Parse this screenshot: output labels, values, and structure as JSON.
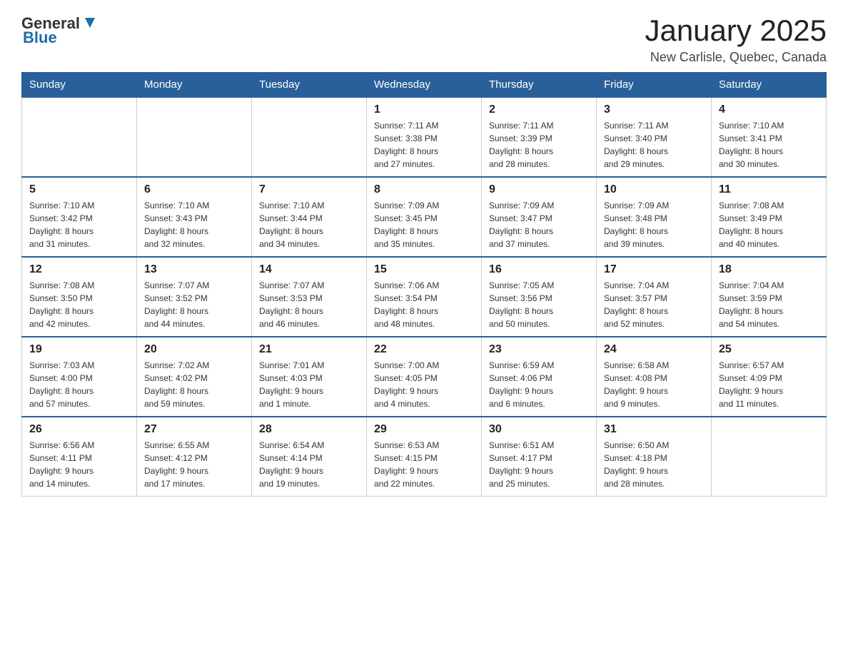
{
  "header": {
    "logo": {
      "text_general": "General",
      "text_blue": "Blue",
      "aria": "GeneralBlue Logo"
    },
    "title": "January 2025",
    "location": "New Carlisle, Quebec, Canada"
  },
  "calendar": {
    "days_of_week": [
      "Sunday",
      "Monday",
      "Tuesday",
      "Wednesday",
      "Thursday",
      "Friday",
      "Saturday"
    ],
    "weeks": [
      {
        "days": [
          {
            "num": "",
            "info": ""
          },
          {
            "num": "",
            "info": ""
          },
          {
            "num": "",
            "info": ""
          },
          {
            "num": "1",
            "info": "Sunrise: 7:11 AM\nSunset: 3:38 PM\nDaylight: 8 hours\nand 27 minutes."
          },
          {
            "num": "2",
            "info": "Sunrise: 7:11 AM\nSunset: 3:39 PM\nDaylight: 8 hours\nand 28 minutes."
          },
          {
            "num": "3",
            "info": "Sunrise: 7:11 AM\nSunset: 3:40 PM\nDaylight: 8 hours\nand 29 minutes."
          },
          {
            "num": "4",
            "info": "Sunrise: 7:10 AM\nSunset: 3:41 PM\nDaylight: 8 hours\nand 30 minutes."
          }
        ]
      },
      {
        "days": [
          {
            "num": "5",
            "info": "Sunrise: 7:10 AM\nSunset: 3:42 PM\nDaylight: 8 hours\nand 31 minutes."
          },
          {
            "num": "6",
            "info": "Sunrise: 7:10 AM\nSunset: 3:43 PM\nDaylight: 8 hours\nand 32 minutes."
          },
          {
            "num": "7",
            "info": "Sunrise: 7:10 AM\nSunset: 3:44 PM\nDaylight: 8 hours\nand 34 minutes."
          },
          {
            "num": "8",
            "info": "Sunrise: 7:09 AM\nSunset: 3:45 PM\nDaylight: 8 hours\nand 35 minutes."
          },
          {
            "num": "9",
            "info": "Sunrise: 7:09 AM\nSunset: 3:47 PM\nDaylight: 8 hours\nand 37 minutes."
          },
          {
            "num": "10",
            "info": "Sunrise: 7:09 AM\nSunset: 3:48 PM\nDaylight: 8 hours\nand 39 minutes."
          },
          {
            "num": "11",
            "info": "Sunrise: 7:08 AM\nSunset: 3:49 PM\nDaylight: 8 hours\nand 40 minutes."
          }
        ]
      },
      {
        "days": [
          {
            "num": "12",
            "info": "Sunrise: 7:08 AM\nSunset: 3:50 PM\nDaylight: 8 hours\nand 42 minutes."
          },
          {
            "num": "13",
            "info": "Sunrise: 7:07 AM\nSunset: 3:52 PM\nDaylight: 8 hours\nand 44 minutes."
          },
          {
            "num": "14",
            "info": "Sunrise: 7:07 AM\nSunset: 3:53 PM\nDaylight: 8 hours\nand 46 minutes."
          },
          {
            "num": "15",
            "info": "Sunrise: 7:06 AM\nSunset: 3:54 PM\nDaylight: 8 hours\nand 48 minutes."
          },
          {
            "num": "16",
            "info": "Sunrise: 7:05 AM\nSunset: 3:56 PM\nDaylight: 8 hours\nand 50 minutes."
          },
          {
            "num": "17",
            "info": "Sunrise: 7:04 AM\nSunset: 3:57 PM\nDaylight: 8 hours\nand 52 minutes."
          },
          {
            "num": "18",
            "info": "Sunrise: 7:04 AM\nSunset: 3:59 PM\nDaylight: 8 hours\nand 54 minutes."
          }
        ]
      },
      {
        "days": [
          {
            "num": "19",
            "info": "Sunrise: 7:03 AM\nSunset: 4:00 PM\nDaylight: 8 hours\nand 57 minutes."
          },
          {
            "num": "20",
            "info": "Sunrise: 7:02 AM\nSunset: 4:02 PM\nDaylight: 8 hours\nand 59 minutes."
          },
          {
            "num": "21",
            "info": "Sunrise: 7:01 AM\nSunset: 4:03 PM\nDaylight: 9 hours\nand 1 minute."
          },
          {
            "num": "22",
            "info": "Sunrise: 7:00 AM\nSunset: 4:05 PM\nDaylight: 9 hours\nand 4 minutes."
          },
          {
            "num": "23",
            "info": "Sunrise: 6:59 AM\nSunset: 4:06 PM\nDaylight: 9 hours\nand 6 minutes."
          },
          {
            "num": "24",
            "info": "Sunrise: 6:58 AM\nSunset: 4:08 PM\nDaylight: 9 hours\nand 9 minutes."
          },
          {
            "num": "25",
            "info": "Sunrise: 6:57 AM\nSunset: 4:09 PM\nDaylight: 9 hours\nand 11 minutes."
          }
        ]
      },
      {
        "days": [
          {
            "num": "26",
            "info": "Sunrise: 6:56 AM\nSunset: 4:11 PM\nDaylight: 9 hours\nand 14 minutes."
          },
          {
            "num": "27",
            "info": "Sunrise: 6:55 AM\nSunset: 4:12 PM\nDaylight: 9 hours\nand 17 minutes."
          },
          {
            "num": "28",
            "info": "Sunrise: 6:54 AM\nSunset: 4:14 PM\nDaylight: 9 hours\nand 19 minutes."
          },
          {
            "num": "29",
            "info": "Sunrise: 6:53 AM\nSunset: 4:15 PM\nDaylight: 9 hours\nand 22 minutes."
          },
          {
            "num": "30",
            "info": "Sunrise: 6:51 AM\nSunset: 4:17 PM\nDaylight: 9 hours\nand 25 minutes."
          },
          {
            "num": "31",
            "info": "Sunrise: 6:50 AM\nSunset: 4:18 PM\nDaylight: 9 hours\nand 28 minutes."
          },
          {
            "num": "",
            "info": ""
          }
        ]
      }
    ]
  }
}
